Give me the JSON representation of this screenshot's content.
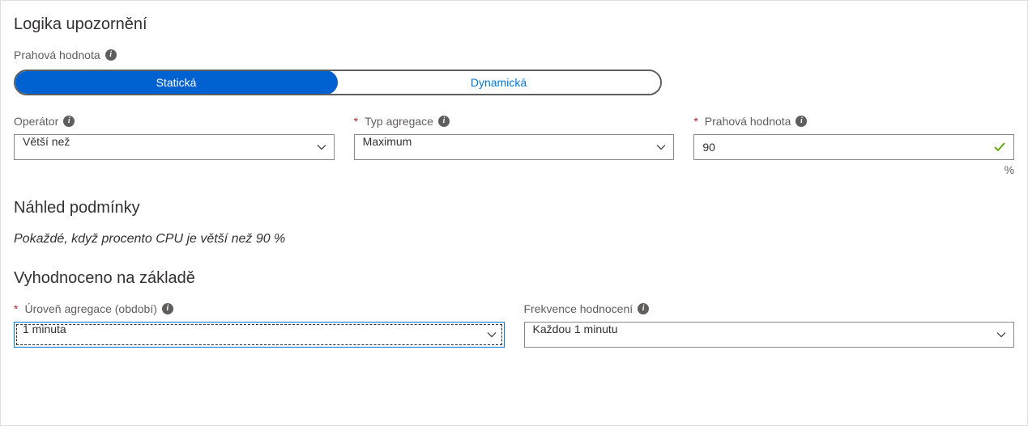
{
  "section_title": "Logika upozornění",
  "threshold_type": {
    "label": "Prahová hodnota",
    "options": {
      "static": "Statická",
      "dynamic": "Dynamická"
    }
  },
  "operator": {
    "label": "Operátor",
    "value": "Větší než"
  },
  "aggregation_type": {
    "label": "Typ agregace",
    "value": "Maximum"
  },
  "threshold_value": {
    "label": "Prahová hodnota",
    "value": "90",
    "unit": "%"
  },
  "condition_preview": {
    "title": "Náhled podmínky",
    "text": "Pokaždé, když procento CPU je větší než 90 %"
  },
  "evaluated_based_on": "Vyhodnoceno na základě",
  "aggregation_level": {
    "label": "Úroveň agregace (období)",
    "value": "1 minuta"
  },
  "evaluation_frequency": {
    "label": "Frekvence hodnocení",
    "value": "Každou 1 minutu"
  }
}
